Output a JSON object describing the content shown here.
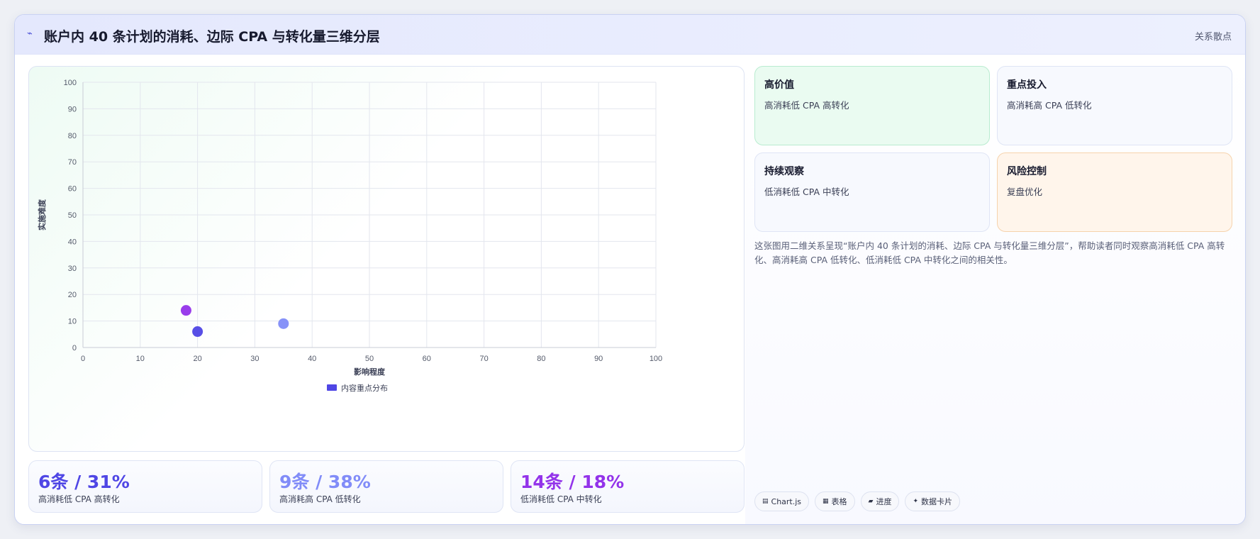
{
  "header": {
    "icon": "trend-line-icon",
    "title": "账户内 40 条计划的消耗、边际 CPA 与转化量三维分层",
    "tag": "关系散点"
  },
  "chart_data": {
    "type": "scatter",
    "xlabel": "影响程度",
    "ylabel": "实施难度",
    "xlim": [
      0,
      100
    ],
    "ylim": [
      0,
      100
    ],
    "xticks": [
      0,
      10,
      20,
      30,
      40,
      50,
      60,
      70,
      80,
      90,
      100
    ],
    "yticks": [
      0,
      10,
      20,
      30,
      40,
      50,
      60,
      70,
      80,
      90,
      100
    ],
    "grid": true,
    "legend_position": "bottom",
    "legend": [
      {
        "label": "内容重点分布",
        "color": "#4f46e5"
      }
    ],
    "points": [
      {
        "x": 18,
        "y": 14,
        "color": "#9333ea"
      },
      {
        "x": 20,
        "y": 6,
        "color": "#4f46e5"
      },
      {
        "x": 35,
        "y": 9,
        "color": "#818cf8"
      }
    ]
  },
  "stats": [
    {
      "value": "6条 / 31%",
      "label": "高消耗低 CPA 高转化",
      "color": "#4f46e5"
    },
    {
      "value": "9条 / 38%",
      "label": "高消耗高 CPA 低转化",
      "color": "#818cf8"
    },
    {
      "value": "14条 / 18%",
      "label": "低消耗低 CPA 中转化",
      "color": "#9333ea"
    }
  ],
  "segments": [
    {
      "title": "高价值",
      "sub": "高消耗低 CPA 高转化",
      "bg": "#eafbf1",
      "border": "#b9ecd0"
    },
    {
      "title": "重点投入",
      "sub": "高消耗高 CPA 低转化",
      "bg": "#f7f9fe",
      "border": "#dfe5f5"
    },
    {
      "title": "持续观察",
      "sub": "低消耗低 CPA 中转化",
      "bg": "#f7f9fe",
      "border": "#dfe5f5"
    },
    {
      "title": "风险控制",
      "sub": "复盘优化",
      "bg": "#fff5eb",
      "border": "#f6d3ad"
    }
  ],
  "description": "这张图用二维关系呈现“账户内 40 条计划的消耗、边际 CPA 与转化量三维分层”，帮助读者同时观察高消耗低 CPA 高转化、高消耗高 CPA 低转化、低消耗低 CPA 中转化之间的相关性。",
  "chips": [
    {
      "icon": "chart-icon",
      "glyph": "▤",
      "label": "Chart.js"
    },
    {
      "icon": "table-icon",
      "glyph": "▦",
      "label": "表格"
    },
    {
      "icon": "progress-icon",
      "glyph": "▰",
      "label": "进度"
    },
    {
      "icon": "sparkle-icon",
      "glyph": "✦",
      "label": "数据卡片"
    }
  ]
}
